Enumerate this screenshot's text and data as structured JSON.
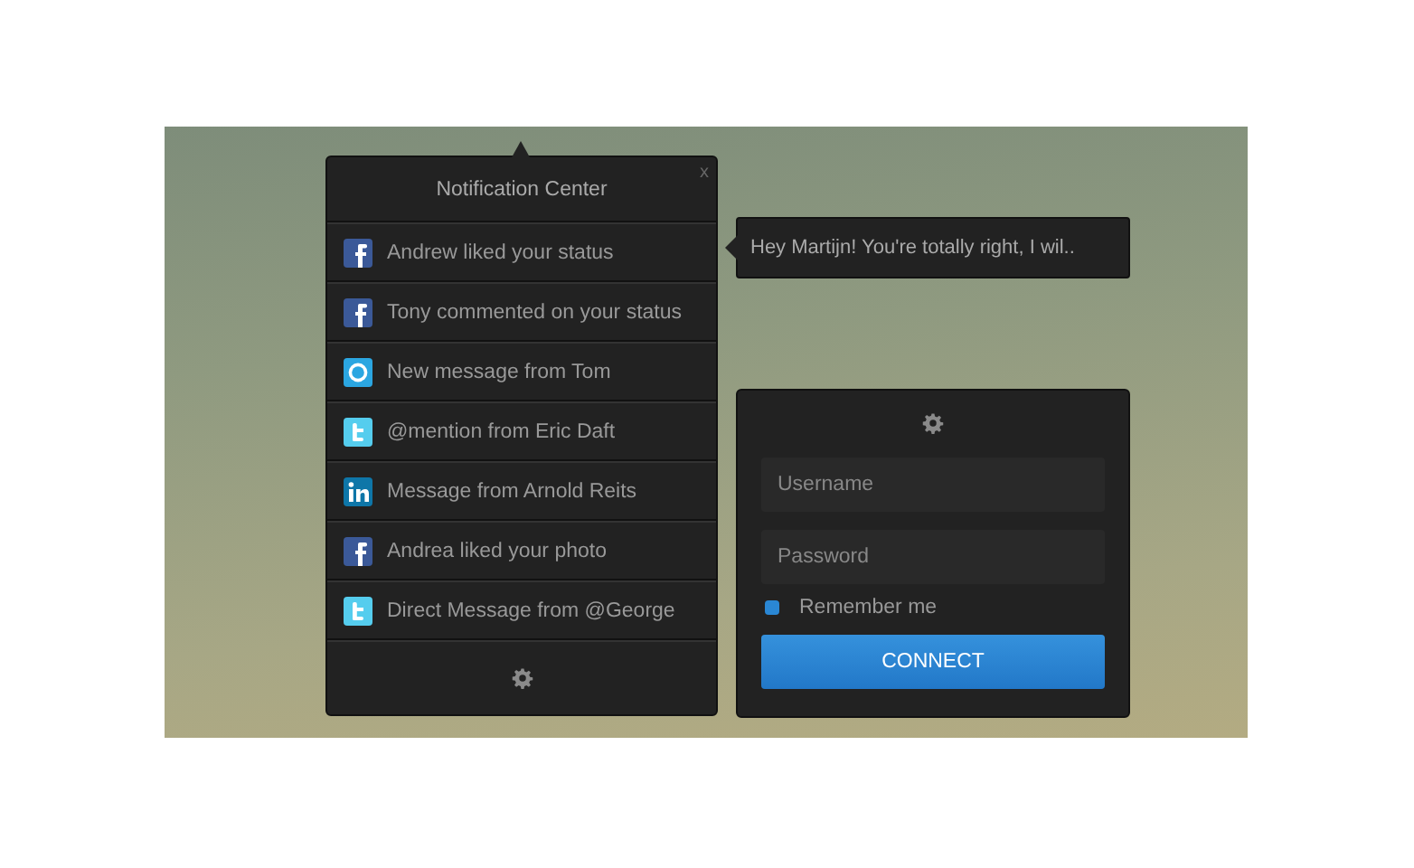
{
  "notification_center": {
    "title": "Notification Center",
    "close": "x",
    "items": [
      {
        "kind": "facebook",
        "text": "Andrew liked your status"
      },
      {
        "kind": "facebook",
        "text": "Tony commented on your status"
      },
      {
        "kind": "skype",
        "text": "New message from Tom"
      },
      {
        "kind": "twitter",
        "text": "@mention from Eric Daft"
      },
      {
        "kind": "linkedin",
        "text": "Message from Arnold Reits"
      },
      {
        "kind": "facebook",
        "text": "Andrea liked your photo"
      },
      {
        "kind": "twitter",
        "text": "Direct Message from @George"
      }
    ]
  },
  "tooltip": {
    "text": "Hey Martijn! You're totally right, I wil.."
  },
  "login": {
    "username": {
      "placeholder": "Username"
    },
    "password": {
      "placeholder": "Password"
    },
    "remember": {
      "label": "Remember me",
      "checked": true
    },
    "button": "CONNECT"
  }
}
